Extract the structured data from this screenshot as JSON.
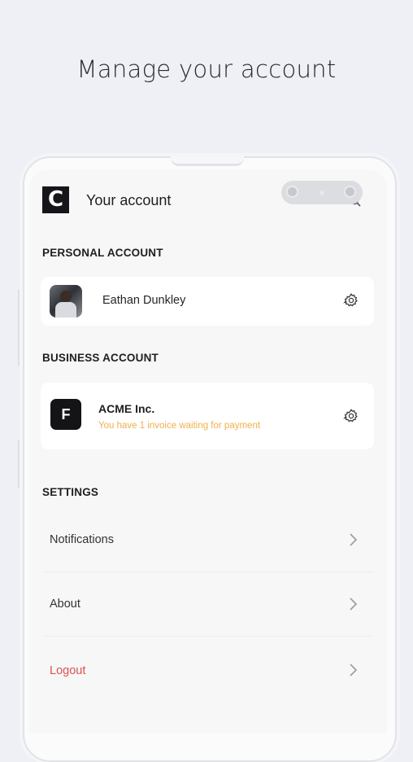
{
  "headline": "Manage your account",
  "app": {
    "logo_letter": "C",
    "title": "Your account"
  },
  "personal": {
    "section_label": "PERSONAL ACCOUNT",
    "name": "Eathan Dunkley"
  },
  "business": {
    "section_label": "BUSINESS ACCOUNT",
    "logo_letter": "F",
    "name": "ACME Inc.",
    "note": "You have 1 invoice waiting for payment",
    "note_color": "#efb04c"
  },
  "settings": {
    "section_label": "SETTINGS",
    "items": [
      {
        "label": "Notifications"
      },
      {
        "label": "About"
      },
      {
        "label": "Logout",
        "color": "#d9534f"
      }
    ]
  },
  "icons": [
    "search-icon",
    "gear-icon",
    "chevron-right-icon"
  ]
}
